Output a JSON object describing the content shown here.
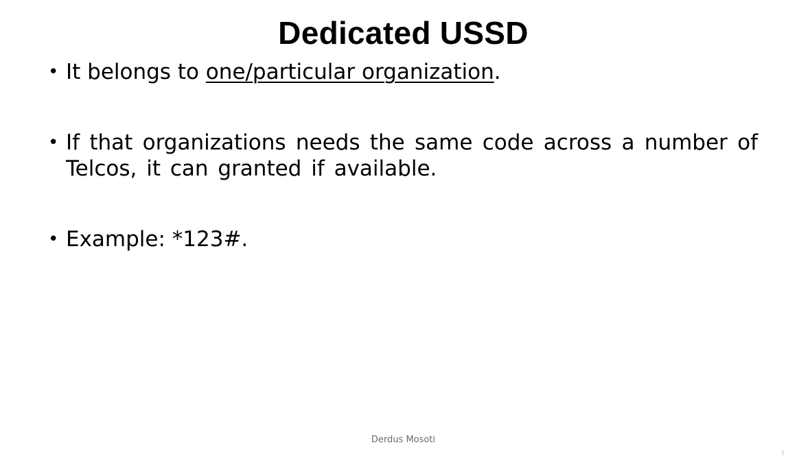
{
  "slide": {
    "title": "Dedicated USSD",
    "bullets": [
      {
        "prefix": "It belongs to ",
        "underlined": "one/particular organization",
        "suffix": "."
      },
      {
        "text": "If that organizations needs the same code across a number of Telcos, it can granted if available."
      },
      {
        "text": "Example: *123#."
      }
    ],
    "bullet_symbol": "•",
    "footer": "Derdus Mosoti",
    "slide_number": "1"
  }
}
